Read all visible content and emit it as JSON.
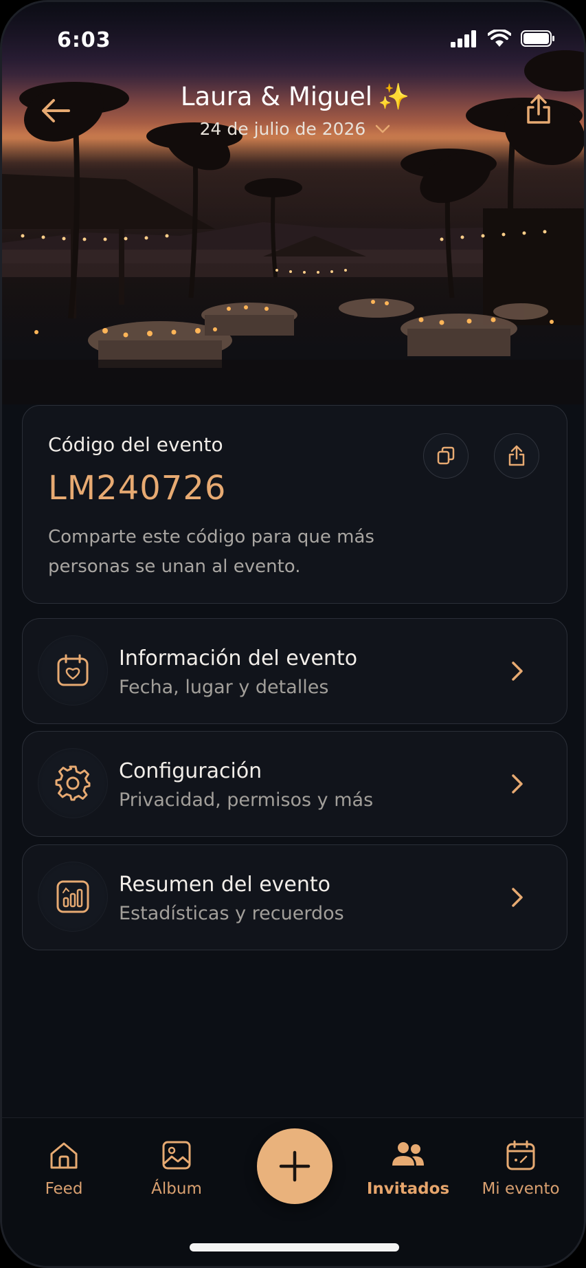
{
  "status_bar": {
    "time": "6:03"
  },
  "header": {
    "title": "Laura & Miguel",
    "title_emoji": "✨",
    "date": "24 de julio de 2026"
  },
  "event_code": {
    "label": "Código del evento",
    "code": "LM240726",
    "description": "Comparte este código para que más personas se unan al evento."
  },
  "menu": [
    {
      "title": "Información del evento",
      "subtitle": "Fecha, lugar y detalles",
      "icon": "calendar-heart-icon"
    },
    {
      "title": "Configuración",
      "subtitle": "Privacidad, permisos y más",
      "icon": "gear-icon"
    },
    {
      "title": "Resumen del evento",
      "subtitle": "Estadísticas y recuerdos",
      "icon": "bar-chart-icon"
    }
  ],
  "tabbar": {
    "tabs": [
      {
        "label": "Feed",
        "icon": "home-icon"
      },
      {
        "label": "Álbum",
        "icon": "image-icon"
      },
      {
        "label": "Invitados",
        "icon": "users-icon",
        "active": true
      },
      {
        "label": "Mi evento",
        "icon": "calendar-icon"
      }
    ],
    "fab_icon": "plus-icon"
  },
  "colors": {
    "accent": "#e7aa72",
    "fab": "#e9b27c",
    "background": "#0c0f15",
    "card_border": "#2b2f38"
  }
}
